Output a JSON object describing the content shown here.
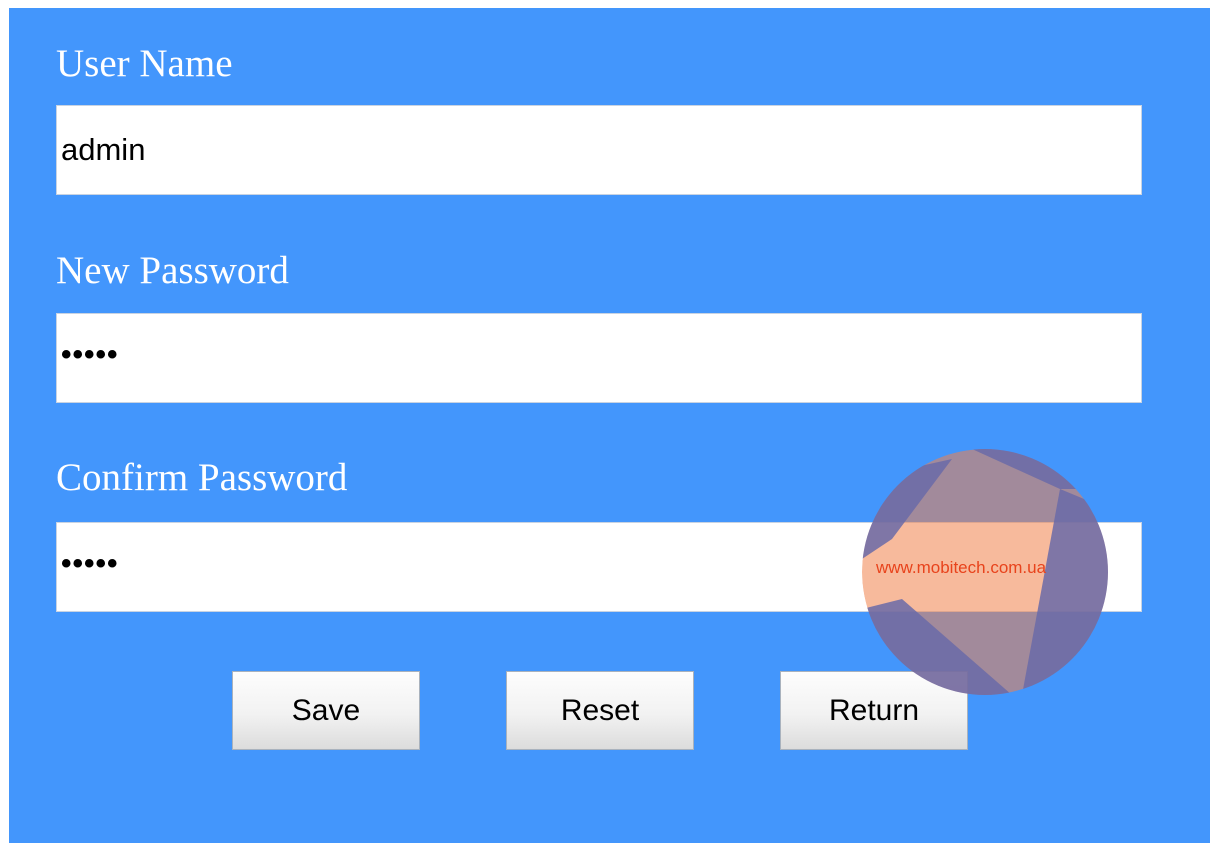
{
  "form": {
    "username_label": "User Name",
    "username_value": "admin",
    "new_password_label": "New Password",
    "new_password_value": "•••••",
    "confirm_password_label": "Confirm Password",
    "confirm_password_value": "•••••"
  },
  "buttons": {
    "save": "Save",
    "reset": "Reset",
    "return": "Return"
  },
  "watermark": {
    "text": "www.mobitech.com.ua"
  },
  "colors": {
    "panel_background": "#4396fc",
    "label_text": "#ffffff",
    "watermark_orange": "#f0824a",
    "watermark_dark": "#6a6aa8"
  }
}
